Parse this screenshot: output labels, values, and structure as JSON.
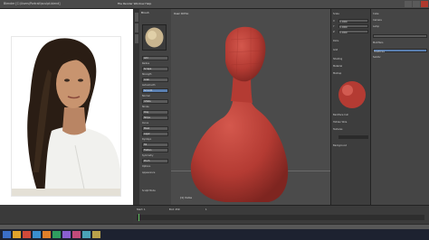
{
  "window": {
    "title": "Blender [C:\\Users\\Portrait\\sculpt.blend]",
    "menu": "File  Render  Window  Help"
  },
  "side_panel": {
    "header": "Brush",
    "buttons": [
      "Add",
      "Scrape",
      "Grab",
      "Smooth",
      "Inflate",
      "Clay",
      "Strips",
      "Mask",
      "Layer",
      "Fill",
      "Flatten",
      "Pinch"
    ],
    "labels": [
      "Radius",
      "Strength",
      "Autosmooth",
      "Normal",
      "Stroke",
      "Curve",
      "Dyntopo",
      "Symmetry",
      "Options",
      "Appearance"
    ],
    "footer": "Sculpt Mode"
  },
  "viewport": {
    "label": "User Ortho",
    "object": "(1) Cube"
  },
  "properties": {
    "rows": [
      "Scale",
      "X",
      "Y",
      "Z",
      "Dims",
      "Grid",
      "Shading",
      "Material",
      "Matcap",
      "Backface Cull",
      "Hidden Wire",
      "Textures",
      "Background"
    ],
    "right_rows": [
      "Cube",
      "Camera",
      "Lamp",
      "Modifiers",
      "Multires",
      "Subdiv"
    ],
    "values": [
      "1.000",
      "1.000",
      "1.000"
    ]
  },
  "timeline": {
    "start": "Start: 1",
    "end": "End: 250",
    "current": "1"
  },
  "colors": {
    "clay": "#c0433a",
    "viewport_bg": "#4b4b4b",
    "panel_bg": "#3d3d3d"
  }
}
